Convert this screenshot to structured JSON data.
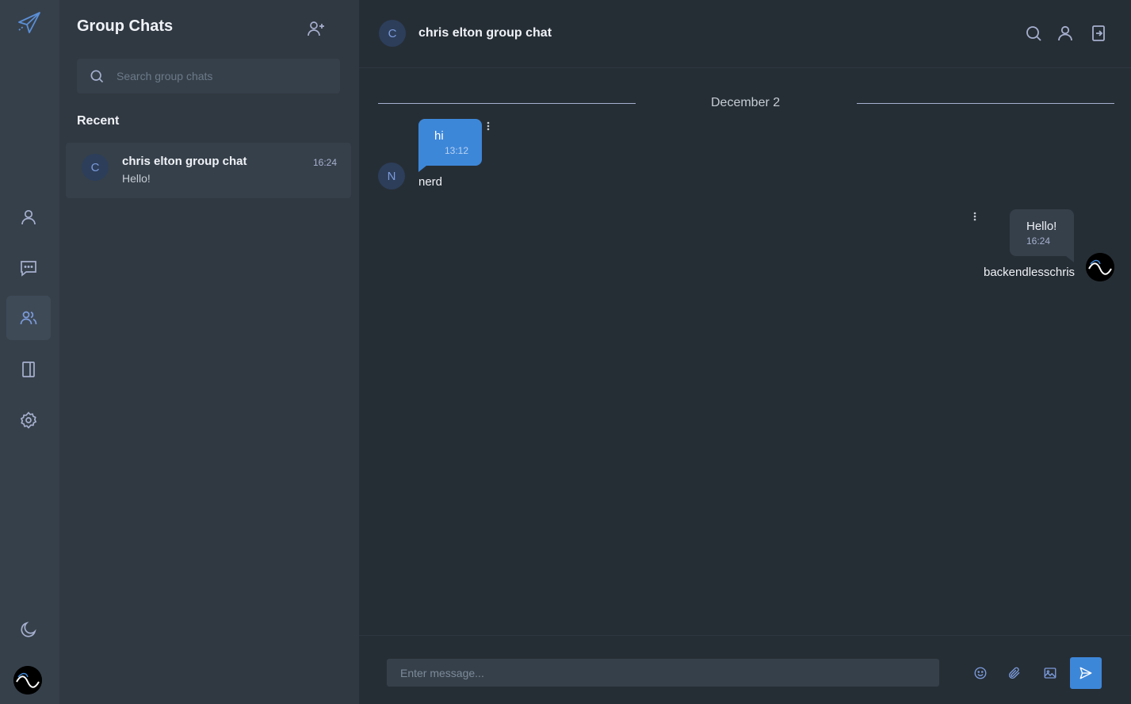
{
  "app": {
    "accent_color": "#3d87d9",
    "logo_icon": "paper-plane-icon"
  },
  "rail": {
    "items": [
      {
        "icon": "user-icon",
        "active": false
      },
      {
        "icon": "chat-bubble-icon",
        "active": false
      },
      {
        "icon": "group-users-icon",
        "active": true
      },
      {
        "icon": "contacts-book-icon",
        "active": false
      },
      {
        "icon": "settings-gear-icon",
        "active": false
      }
    ],
    "theme_icon": "moon-icon"
  },
  "panel": {
    "title": "Group Chats",
    "search_placeholder": "Search group chats",
    "recent_label": "Recent",
    "chats": [
      {
        "avatar_letter": "C",
        "name": "chris elton group chat",
        "preview": "Hello!",
        "time": "16:24"
      }
    ]
  },
  "chat": {
    "header": {
      "avatar_letter": "C",
      "name": "chris elton group chat"
    },
    "date_divider": "December 2",
    "messages": [
      {
        "direction": "in",
        "text": "hi",
        "time": "13:12",
        "sender": "nerd",
        "avatar_letter": "N"
      },
      {
        "direction": "out",
        "text": "Hello!",
        "time": "16:24",
        "sender": "backendlesschris"
      }
    ],
    "input_placeholder": "Enter message..."
  }
}
